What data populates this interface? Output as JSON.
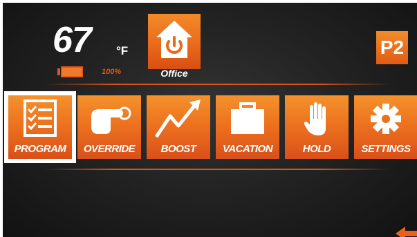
{
  "temperature": {
    "value": "67",
    "unit": "°F"
  },
  "battery": {
    "percent_label": "100%",
    "level": 1.0
  },
  "zone": {
    "label": "Office"
  },
  "profile": {
    "label": "P2"
  },
  "menu": [
    {
      "id": "program",
      "label": "PROGRAM",
      "icon": "checklist-icon",
      "selected": true
    },
    {
      "id": "override",
      "label": "OVERRIDE",
      "icon": "pointing-hand-icon",
      "selected": false
    },
    {
      "id": "boost",
      "label": "BOOST",
      "icon": "trend-up-arrow-icon",
      "selected": false
    },
    {
      "id": "vacation",
      "label": "VACATION",
      "icon": "suitcase-icon",
      "selected": false
    },
    {
      "id": "hold",
      "label": "HOLD",
      "icon": "raised-hand-icon",
      "selected": false
    },
    {
      "id": "settings",
      "label": "SETTINGS",
      "icon": "gear-icon",
      "selected": false
    }
  ],
  "colors": {
    "accent": "#ec6f1e",
    "background": "#232323",
    "text": "#ffffff"
  }
}
